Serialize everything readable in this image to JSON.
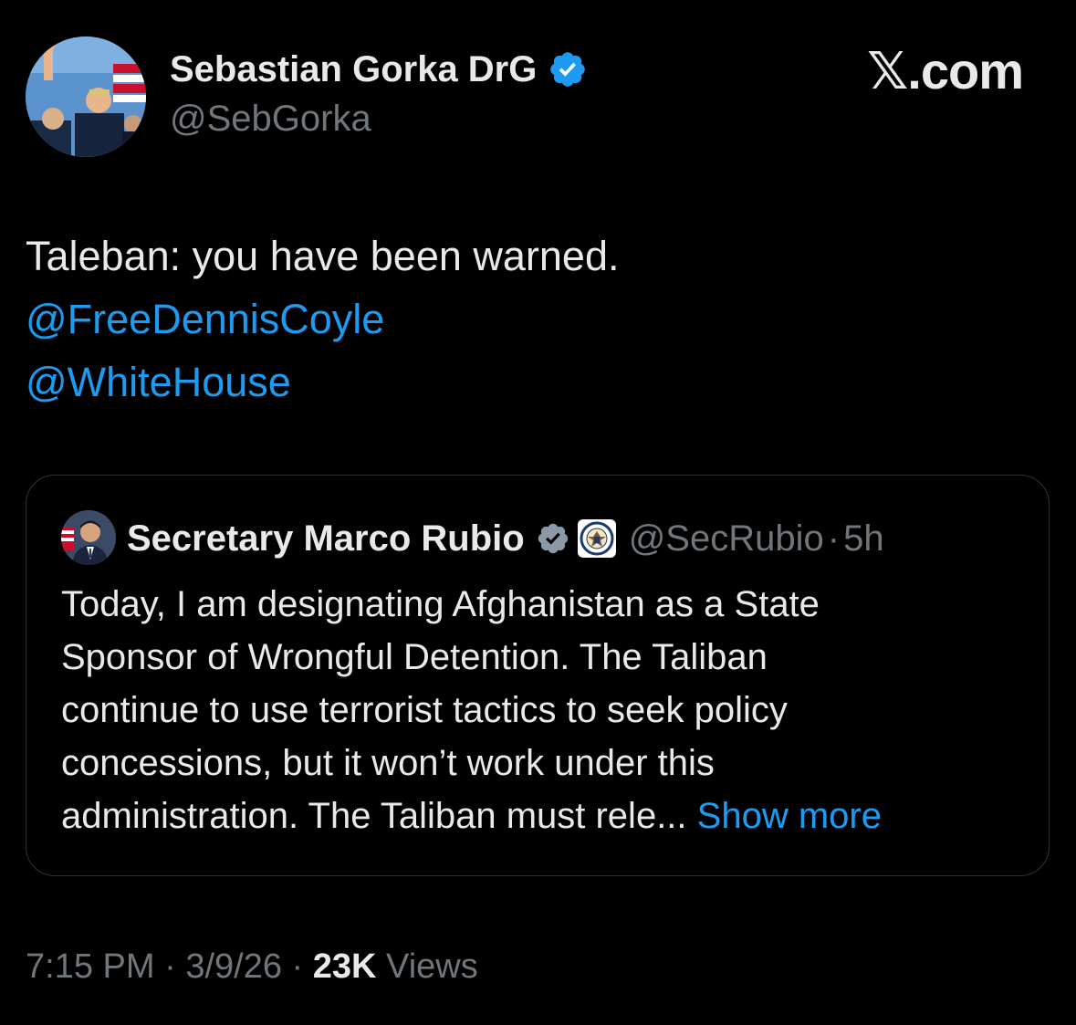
{
  "author": {
    "display_name": "Sebastian Gorka DrG",
    "handle": "@SebGorka"
  },
  "site_brand": "𝕏.com",
  "tweet": {
    "text": "Taleban: you have been warned.",
    "mentions": [
      "@FreeDennisCoyle",
      "@WhiteHouse"
    ]
  },
  "quote": {
    "display_name": "Secretary Marco Rubio",
    "handle": "@SecRubio",
    "separator": "·",
    "age": "5h",
    "lines": [
      "Today, I am designating Afghanistan as a State",
      "Sponsor of Wrongful Detention. The Taliban",
      "continue to use terrorist tactics to seek policy",
      "concessions, but it won’t work under this",
      "administration. The Taliban must rele..."
    ],
    "show_more": "Show more"
  },
  "footer": {
    "time": "7:15 PM",
    "separator": "·",
    "date": "3/9/26",
    "views_count": "23K",
    "views_label": "Views"
  },
  "colors": {
    "background": "#000000",
    "text": "#e7e9ea",
    "secondary": "#71767b",
    "link": "#1d9bf0",
    "verified": "#1d9bf0",
    "verified_quote": "#8b98a5",
    "border": "#2f3336"
  },
  "icons": {
    "author_verified": "verified-badge-icon",
    "quote_verified": "verified-badge-icon",
    "quote_affiliate": "state-department-seal-icon"
  }
}
